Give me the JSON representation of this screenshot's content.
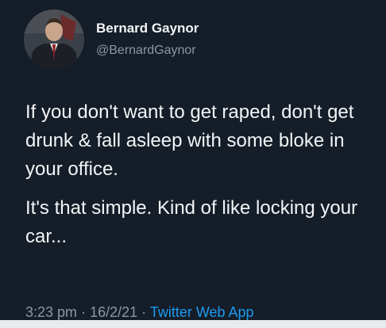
{
  "author": {
    "display_name": "Bernard Gaynor",
    "handle": "@BernardGaynor",
    "avatar_icon": "profile-photo"
  },
  "tweet": {
    "paragraphs": [
      "If you don't want to get raped, don't get drunk & fall asleep with some bloke in your office.",
      "It's that simple. Kind of like locking your car..."
    ]
  },
  "meta": {
    "time": "3:23 pm",
    "separator": "·",
    "date": "16/2/21",
    "source": "Twitter Web App"
  },
  "colors": {
    "background": "#151d28",
    "text": "#f3f5f7",
    "secondary": "#8b98a5",
    "link": "#1d9bf0"
  }
}
